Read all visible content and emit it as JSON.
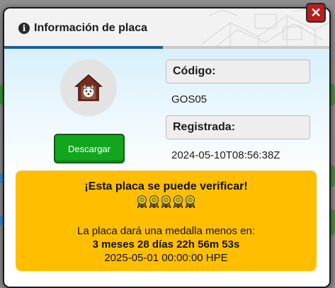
{
  "modal": {
    "title": "Información de placa",
    "info_icon": "info-icon",
    "close_icon": "close-icon",
    "close_label": "✕"
  },
  "badge": {
    "icon": "dog-house-badge-icon",
    "download_label": "Descargar"
  },
  "details": {
    "code_label": "Código:",
    "code_value": "GOS05",
    "registered_label": "Registrada:",
    "registered_value": "2024-05-10T08:56:38Z"
  },
  "verify": {
    "title": "¡Esta placa se puede verificar!",
    "medal_icon": "medal-icon",
    "medal_count": 5,
    "countdown_intro": "La placa dará una medalla menos en:",
    "countdown": "3 meses 28 días 22h 56m 53s",
    "date": "2025-05-01 00:00:00 HPE"
  },
  "colors": {
    "accent_blue": "#1c5f97",
    "download_green": "#12a61e",
    "panel_yellow": "#ffbf00",
    "close_red": "#b81e1e"
  }
}
